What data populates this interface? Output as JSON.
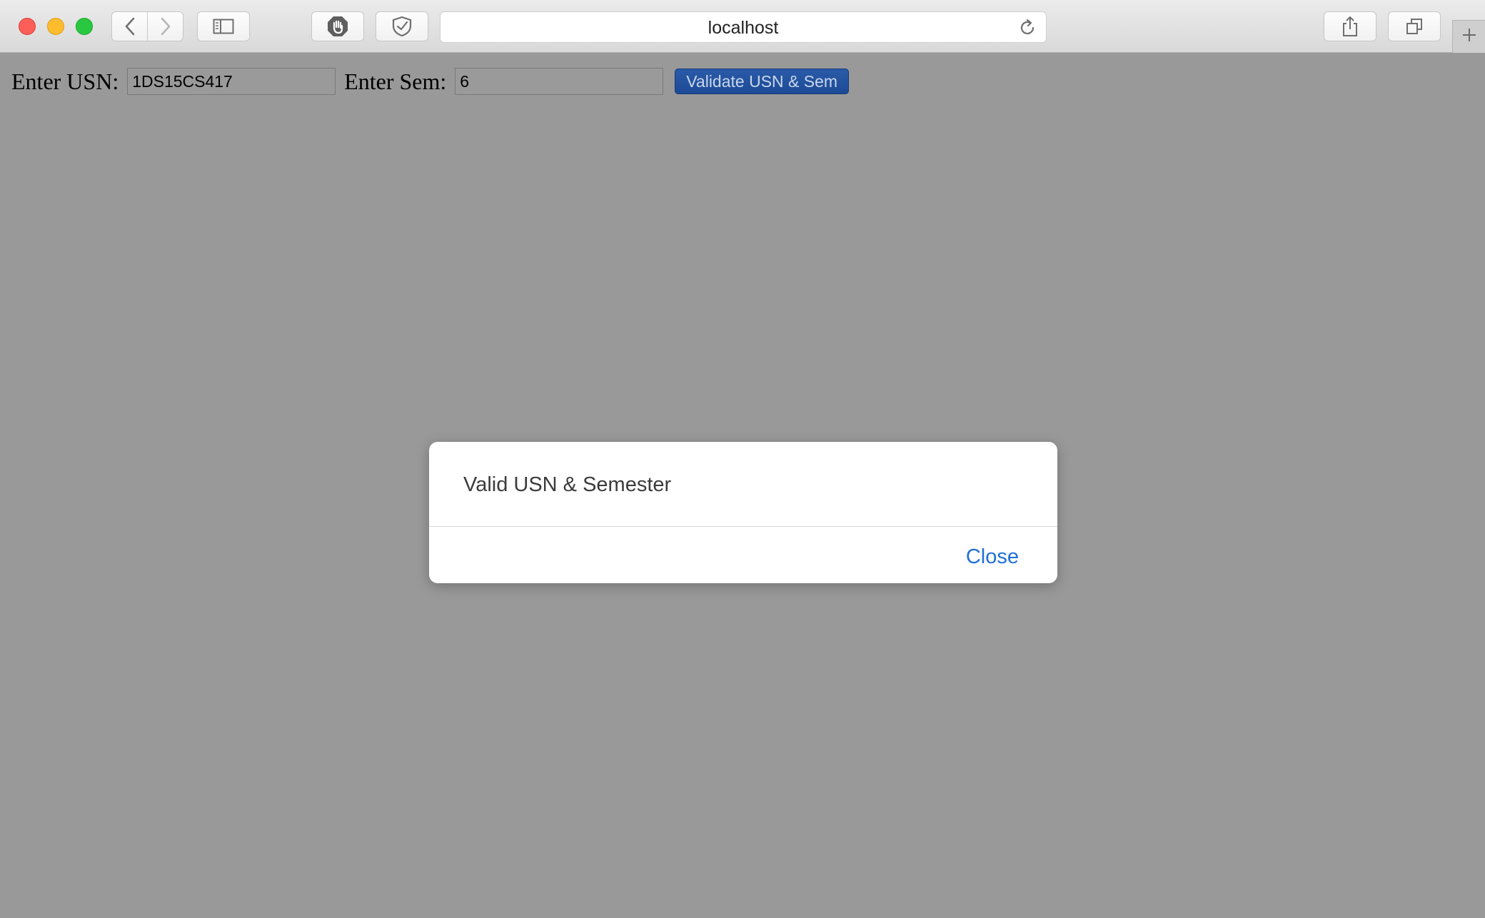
{
  "browser": {
    "address": "localhost"
  },
  "form": {
    "usn_label": "Enter USN:",
    "usn_value": "1DS15CS417",
    "sem_label": "Enter Sem:",
    "sem_value": "6",
    "validate_label": "Validate USN & Sem"
  },
  "dialog": {
    "message": "Valid USN & Semester",
    "close_label": "Close"
  },
  "colors": {
    "page_background": "#999999",
    "validate_button": "#1d4a96",
    "dialog_link": "#1f6fd8"
  },
  "icons": [
    "back-icon",
    "forward-icon",
    "sidebar-icon",
    "hand-stop-icon",
    "shield-icon",
    "reload-icon",
    "share-icon",
    "tabs-icon",
    "plus-icon"
  ]
}
